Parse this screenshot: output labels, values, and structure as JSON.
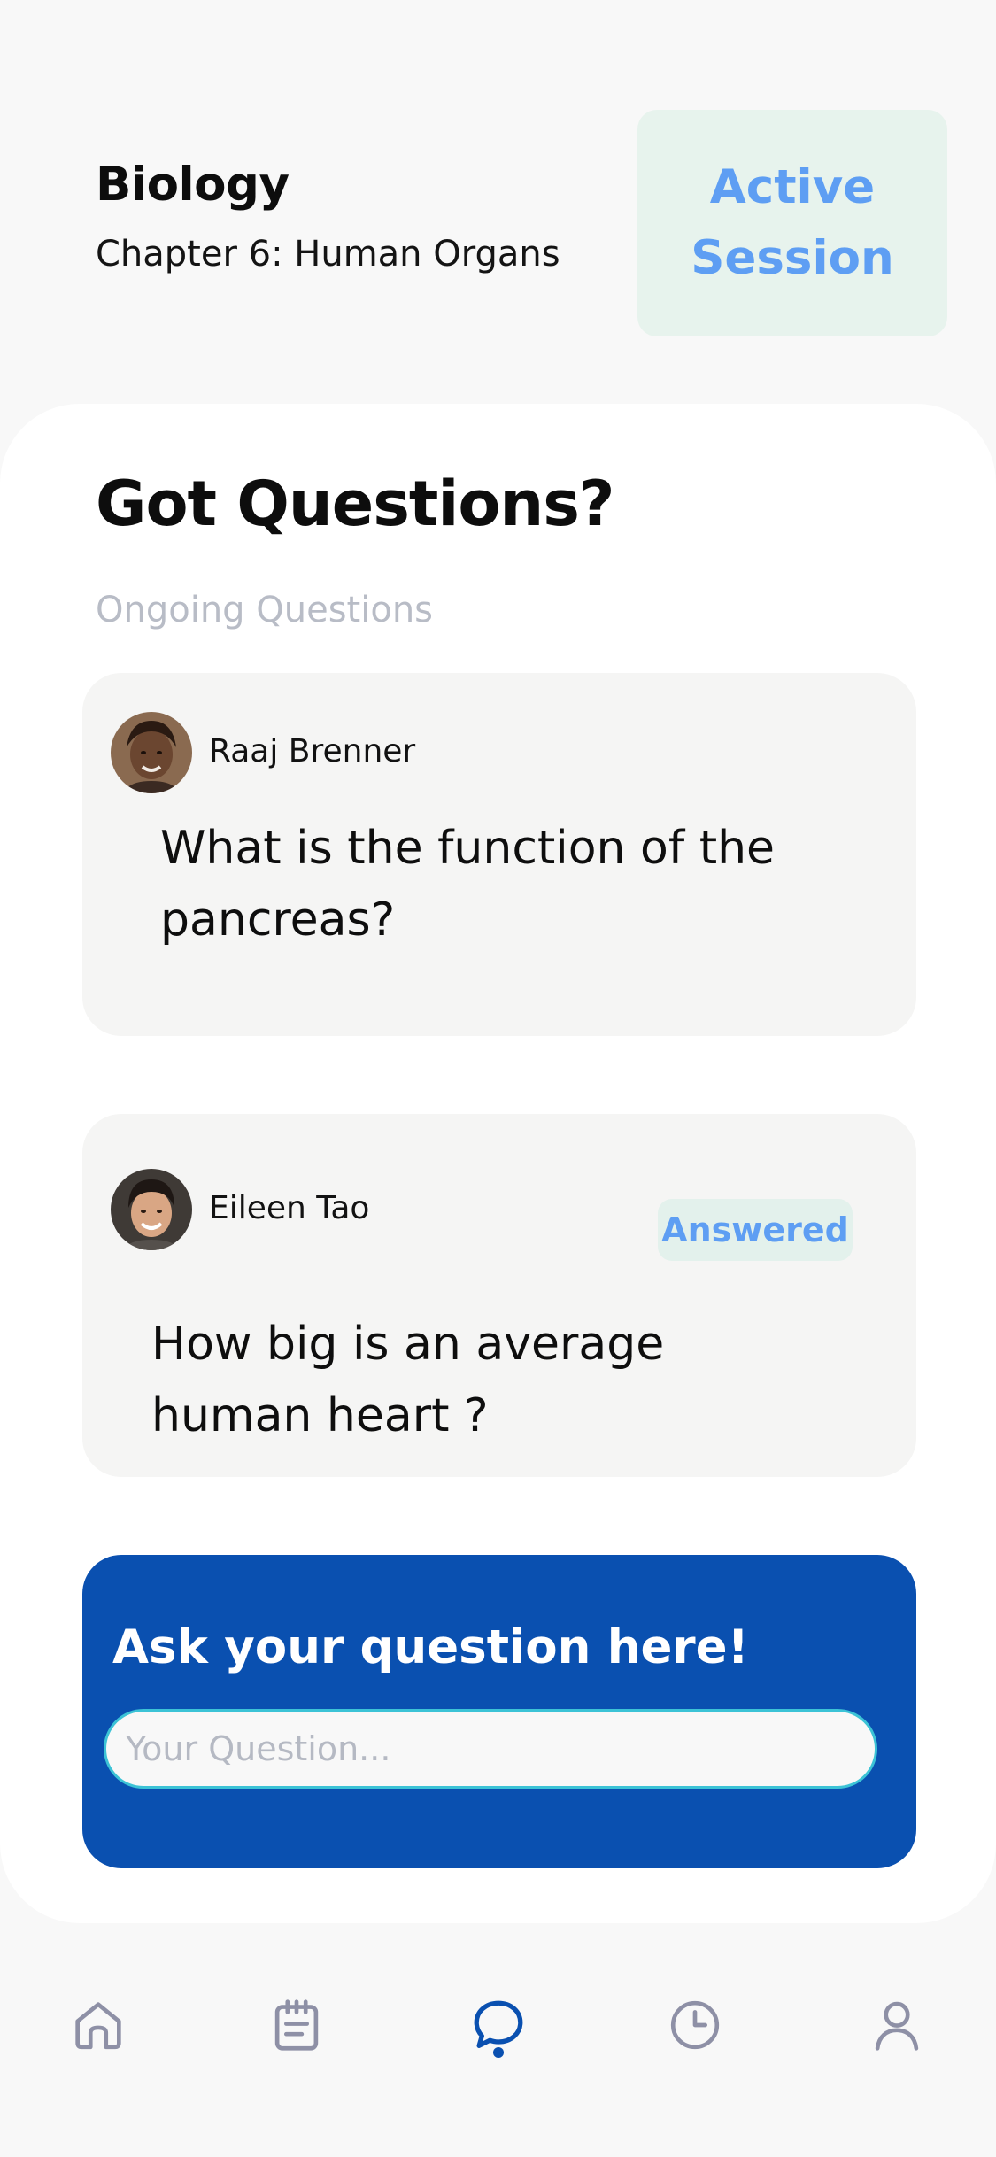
{
  "header": {
    "subject": "Biology",
    "chapter": "Chapter 6: Human Organs",
    "session_status": "Active Session"
  },
  "main": {
    "title": "Got Questions?",
    "section_label": "Ongoing Questions",
    "questions": [
      {
        "author": "Raaj Brenner",
        "avatar_icon": "avatar-icon",
        "text": "What is the function of the pancreas?",
        "status": ""
      },
      {
        "author": "Eileen Tao",
        "avatar_icon": "avatar-icon",
        "text": "How big is an average human heart ?",
        "status": "Answered"
      }
    ]
  },
  "ask": {
    "title": "Ask your question here!",
    "placeholder": "Your Question...",
    "value": ""
  },
  "nav": {
    "items": [
      {
        "icon": "home-icon",
        "active": false
      },
      {
        "icon": "notes-icon",
        "active": false
      },
      {
        "icon": "chat-icon",
        "active": true
      },
      {
        "icon": "clock-icon",
        "active": false
      },
      {
        "icon": "profile-icon",
        "active": false
      }
    ]
  },
  "colors": {
    "accent": "#0a50b0",
    "badge_text": "#5e9ef3",
    "badge_bg": "#e7f3ed",
    "nav_inactive": "#8e90a6"
  }
}
